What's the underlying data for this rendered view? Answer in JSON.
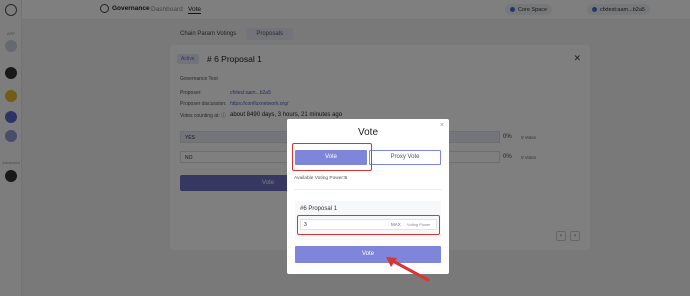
{
  "sidebar": {
    "section_app": "APP",
    "section_advanced": "Advanced",
    "icons": [
      "app-switch-icon",
      "shield-icon",
      "bulb-icon",
      "governance-icon",
      "swap-icon"
    ]
  },
  "topbar": {
    "brand": "Governance",
    "nav": [
      "Dashboard",
      "Vote"
    ],
    "network": "Core Space",
    "account": "cfxtest:aam...b2a5"
  },
  "tabs": [
    "Chain Param Votings",
    "Proposals"
  ],
  "proposal": {
    "status": "Active",
    "title": "# 6 Proposal 1",
    "subtitle": "Governance Test",
    "proposer_label": "Proposer:",
    "proposer_value": "cfxtest:aam...b2a5",
    "discussion_label": "Proposer discussion:",
    "discussion_value": "https://confluxnetwork.org/",
    "counting_label": "Votes counting at: ⓘ",
    "counting_value": "about 8490 days, 3 hours, 21 minutes ago",
    "options": [
      {
        "label": "YES",
        "percent": "0%",
        "votes": "0 Votes"
      },
      {
        "label": "NO",
        "percent": "0%",
        "votes": "0 Votes"
      }
    ],
    "vote_button": "Vote"
  },
  "modal": {
    "title": "Vote",
    "close": "×",
    "tab_vote": "Vote",
    "tab_proxy": "Proxy Vote",
    "available_label": "Available Voting Power:",
    "available_value": "5",
    "proposal_name": "#6 Proposal 1",
    "amount": "3",
    "max_label": "MAX",
    "unit_label": "Voting Power",
    "submit": "Vote"
  },
  "colors": {
    "accent": "#7f85d9",
    "highlight": "#dd3333"
  }
}
